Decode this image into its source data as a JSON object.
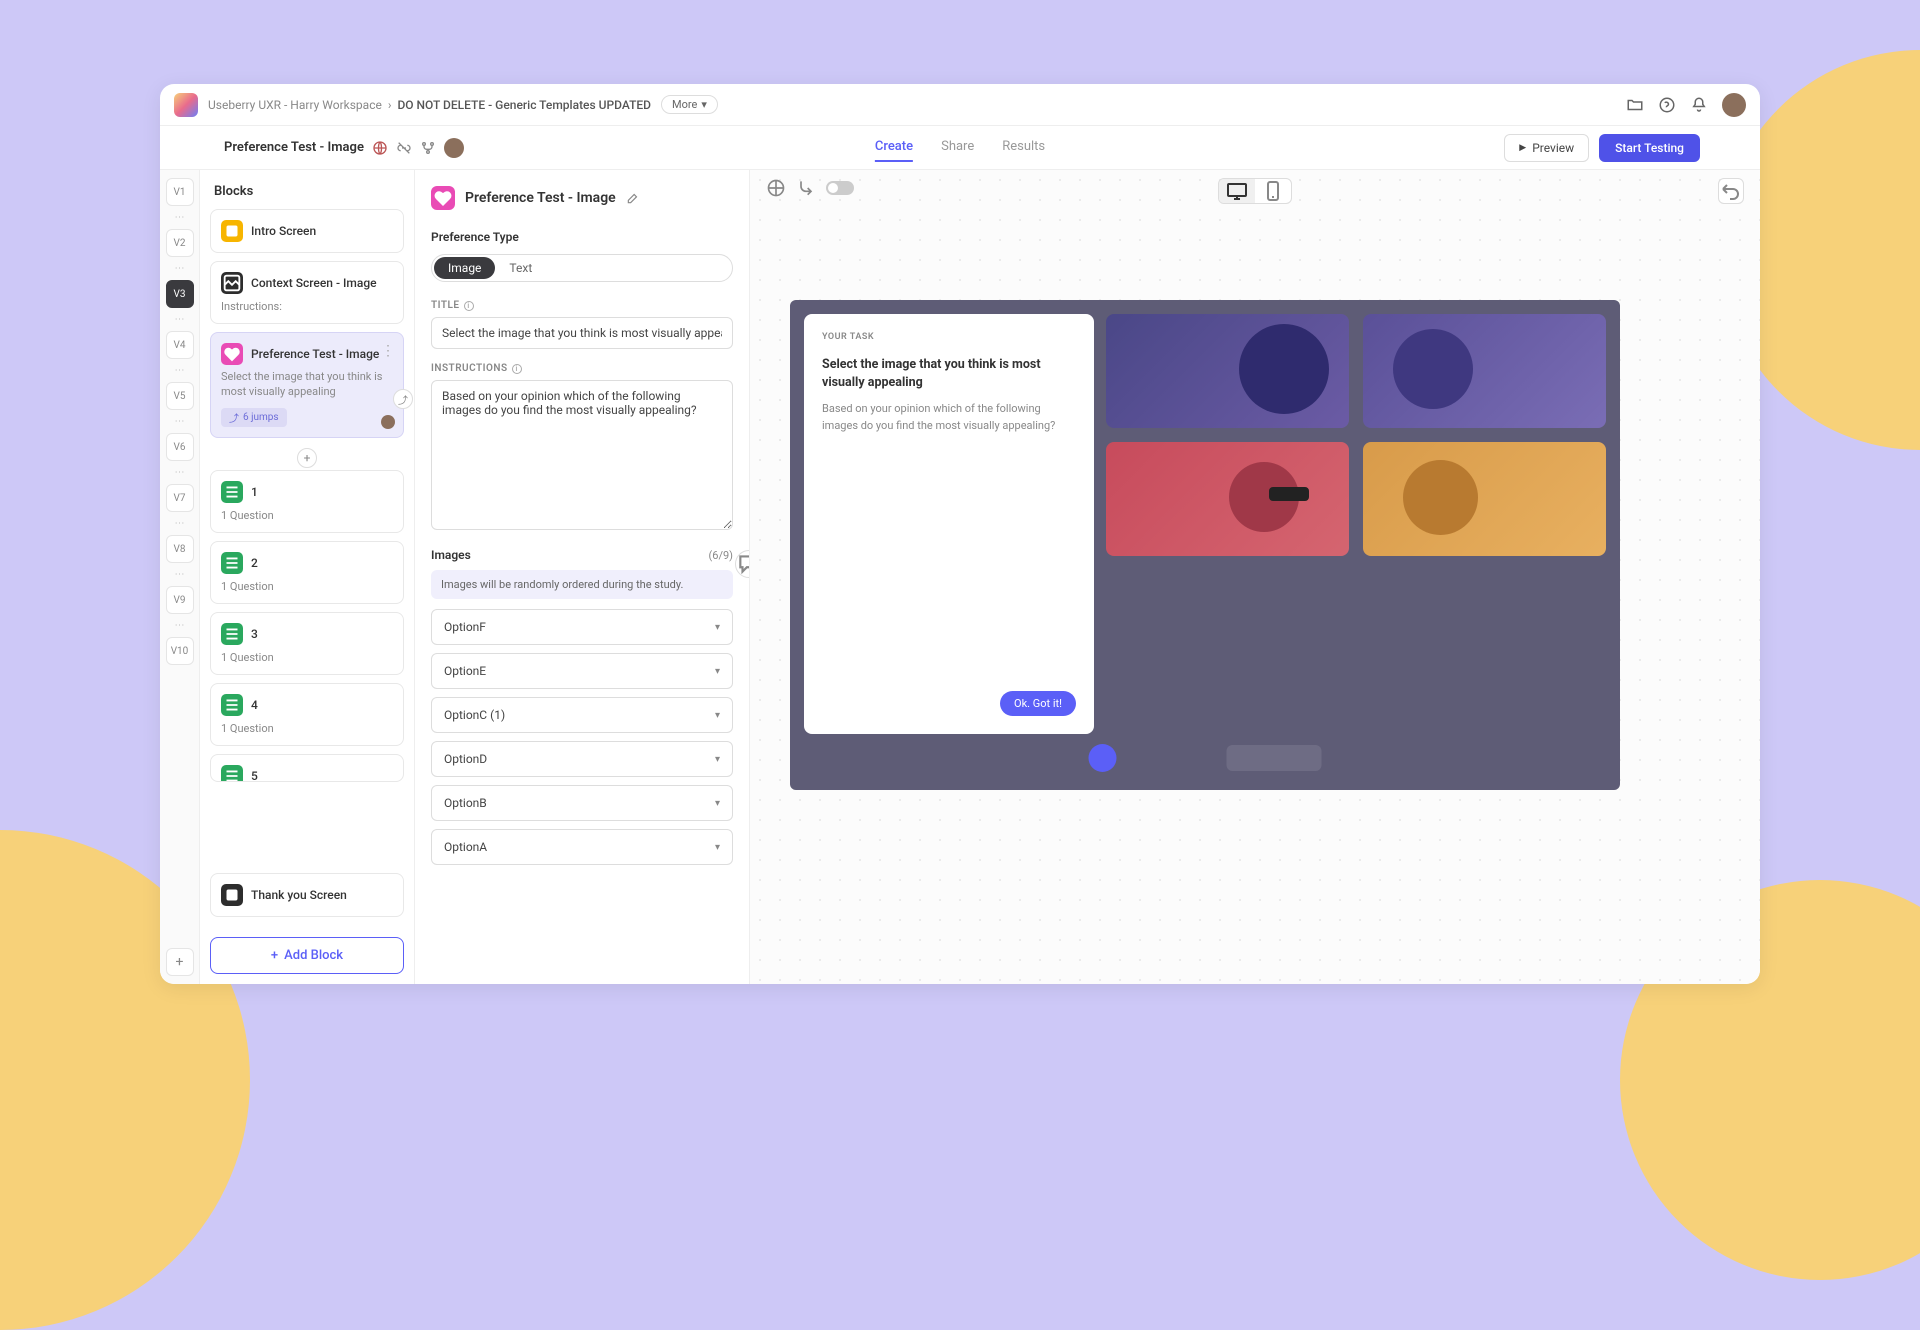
{
  "breadcrumb": {
    "workspace": "Useberry UXR - Harry Workspace",
    "project": "DO NOT DELETE - Generic Templates UPDATED",
    "more": "More"
  },
  "topbar": {
    "folder_icon": "folder",
    "help_icon": "help",
    "bell_icon": "notifications"
  },
  "subbar": {
    "title": "Preference Test - Image",
    "tabs": {
      "create": "Create",
      "share": "Share",
      "results": "Results"
    },
    "preview": "Preview",
    "start": "Start Testing"
  },
  "versions": [
    "V1",
    "V2",
    "V3",
    "V4",
    "V5",
    "V6",
    "V7",
    "V8",
    "V9",
    "V10"
  ],
  "active_version": "V3",
  "blocks": {
    "header": "Blocks",
    "intro": "Intro Screen",
    "context": "Context Screen - Image",
    "context_sub": "Instructions:",
    "pref": "Preference Test - Image",
    "pref_desc": "Select the image that you think is most visually appealing",
    "jumps": "6 jumps",
    "q": [
      "1",
      "2",
      "3",
      "4",
      "5"
    ],
    "q_sub": "1 Question",
    "thankyou": "Thank you Screen",
    "add": "Add Block"
  },
  "editor": {
    "title": "Preference Test - Image",
    "pref_type": "Preference Type",
    "image": "Image",
    "text": "Text",
    "title_label": "TITLE",
    "title_value": "Select the image that you think is most visually appealing",
    "instructions_label": "INSTRUCTIONS",
    "instructions_value": "Based on your opinion which of the following images do you find the most visually appealing?",
    "images_label": "Images",
    "images_count": "(6/9)",
    "images_note": "Images will be randomly ordered during the study.",
    "options": [
      "OptionF",
      "OptionE",
      "OptionC (1)",
      "OptionD",
      "OptionB",
      "OptionA"
    ]
  },
  "preview": {
    "task_label": "YOUR TASK",
    "task_title": "Select the image that you think is most visually appealing",
    "task_text": "Based on your opinion which of the following images do you find the most visually appealing?",
    "ok": "Ok. Got it!"
  }
}
